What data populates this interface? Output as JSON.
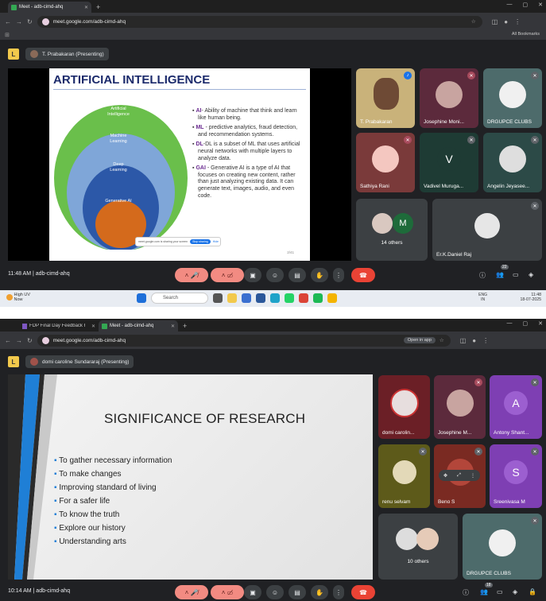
{
  "shot1": {
    "tabs": [
      {
        "title": "Meet - adb-cimd-ahq"
      }
    ],
    "url": "meet.google.com/adb-cimd-ahq",
    "bookmarks_label": "All Bookmarks",
    "presenting": "T. Prabakaran (Presenting)",
    "slide": {
      "title": "ARTIFICIAL INTELLIGENCE",
      "circles": [
        "Artificial Intelligence",
        "Machine Learning",
        "Deep Learning",
        "Generative AI"
      ],
      "bullets": [
        {
          "key": "AI",
          "text": "- Ability of machine that think and learn like human being."
        },
        {
          "key": "ML",
          "text": " - predictive analytics, fraud detection, and recommendation systems."
        },
        {
          "key": "DL",
          "text": "-DL is a subset of ML that uses artificial neural networks with multiple layers to analyze data."
        },
        {
          "key": "GAI",
          "text": " - Generative AI is a type of AI that focuses on creating new content, rather than just analyzing existing data. It can generate text, images, audio, and even code."
        }
      ],
      "share_bar_text": "meet.google.com is sharing your screen",
      "stop_sharing": "Stop sharing",
      "hide": "Hide",
      "page": "2/41"
    },
    "participants": [
      {
        "name": "T. Prabakaran",
        "color": "#c9b27a"
      },
      {
        "name": "Josephine Moni...",
        "color": "#5c2a3c"
      },
      {
        "name": "DRGUPCE CLUBS",
        "color": "#4d6b6b"
      },
      {
        "name": "Sathiya Rani",
        "color": "#7a3a3a"
      },
      {
        "name": "Vadivel Muruga...",
        "color": "#1e3b34",
        "initial": "V"
      },
      {
        "name": "Angelin Jeyasee...",
        "color": "#2c4a47"
      },
      {
        "name": "14 others",
        "color": "#3c4043",
        "initial": "M"
      },
      {
        "name": "Er.K.Daniel Raj",
        "color": "#3c4043"
      }
    ],
    "time": "11:48 AM",
    "meeting_code": "adb-cimd-ahq",
    "people_count": "22",
    "taskbar": {
      "weather1": "High UV",
      "weather2": "Now",
      "search": "Search",
      "lang1": "ENG",
      "lang2": "IN",
      "clock_time": "11:48",
      "clock_date": "18-07-2025"
    }
  },
  "shot2": {
    "tabs": [
      {
        "title": "FDP Final Day Feedback Form"
      },
      {
        "title": "Meet - adb-cimd-ahq"
      }
    ],
    "url": "meet.google.com/adb-cimd-ahq",
    "open_in_app": "Open in app",
    "presenting": "domi caroline Sundararaj (Presenting)",
    "slide": {
      "title": "SIGNIFICANCE OF RESEARCH",
      "bullets": [
        "To gather necessary information",
        "To make changes",
        "Improving standard of living",
        "For a safer life",
        "To know the truth",
        "Explore our history",
        "Understanding arts"
      ]
    },
    "participants": [
      {
        "name": "domi carolin...",
        "color": "#6b1f26"
      },
      {
        "name": "Josephine M...",
        "color": "#5c2a3c"
      },
      {
        "name": "Antony Shant...",
        "color": "#7e3fb3",
        "initial": "A"
      },
      {
        "name": "renu selvam",
        "color": "#5d5a1a"
      },
      {
        "name": "Beno S",
        "color": "#7a2a22"
      },
      {
        "name": "Sreenivasa M",
        "color": "#7e3fb3",
        "initial": "S"
      },
      {
        "name": "10 others",
        "color": "#3c4043"
      },
      {
        "name": "DRGUPCE CLUBS",
        "color": "#4d6b6b"
      }
    ],
    "time": "10:14 AM",
    "meeting_code": "adb-cimd-ahq",
    "people_count": "18"
  }
}
